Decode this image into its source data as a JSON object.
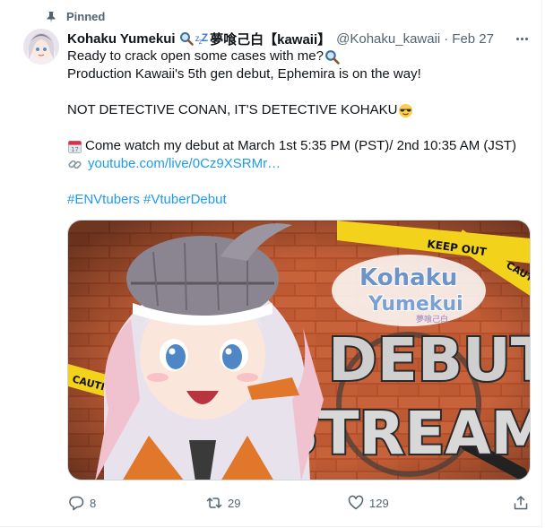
{
  "pinned_label": "Pinned",
  "author": {
    "display_name": "Kohaku Yumekui",
    "display_name_suffix": "夢喰己白【kawaii】",
    "handle": "@Kohaku_kawaii",
    "separator": "·",
    "date": "Feb 27"
  },
  "tweet": {
    "line1": "Ready to crack open some cases with me?",
    "line2": "Production Kawaii's 5th gen debut, Ephemira is on the way!",
    "line3": "NOT DETECTIVE CONAN, IT'S DETECTIVE KOHAKU",
    "line4": "Come watch my debut at March 1st 5:35 PM (PST)/ 2nd 10:35 AM (JST)",
    "link": "youtube.com/live/0Cz9XSRMr…",
    "hashtags": "#ENVtubers #VtuberDebut"
  },
  "media": {
    "title_line1": "DEBUT",
    "title_line2": "STREAM",
    "logo_line1": "Kohaku",
    "logo_line2": "Yumekui",
    "logo_sub": "夢喰己白",
    "tape_text": "KEEP OUT",
    "tape_caution": "CAUTION"
  },
  "actions": {
    "replies": "8",
    "retweets": "29",
    "likes": "129"
  },
  "colors": {
    "accent": "#1d9bf0",
    "muted": "#536471",
    "text": "#0f1419"
  }
}
